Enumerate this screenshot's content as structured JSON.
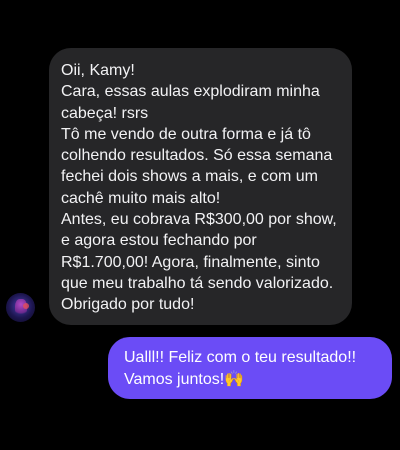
{
  "received_message": {
    "lines": [
      "Oii, Kamy!",
      "Cara, essas aulas explodiram minha cabeça! rsrs",
      "Tô me vendo de outra forma e já tô colhendo resultados. Só essa semana fechei dois shows a mais, e com um cachê muito mais alto!",
      "Antes, eu cobrava R$300,00 por show, e agora estou fechando por R$1.700,00! Agora, finalmente, sinto que meu trabalho tá sendo valorizado. Obrigado por tudo!"
    ]
  },
  "sent_message": {
    "line1": "Ualll!! Feliz com o teu resultado!!",
    "line2": "Vamos juntos!",
    "emoji": "🙌"
  },
  "colors": {
    "background": "#000000",
    "received_bubble": "#262628",
    "sent_bubble": "#6b4cf6"
  }
}
